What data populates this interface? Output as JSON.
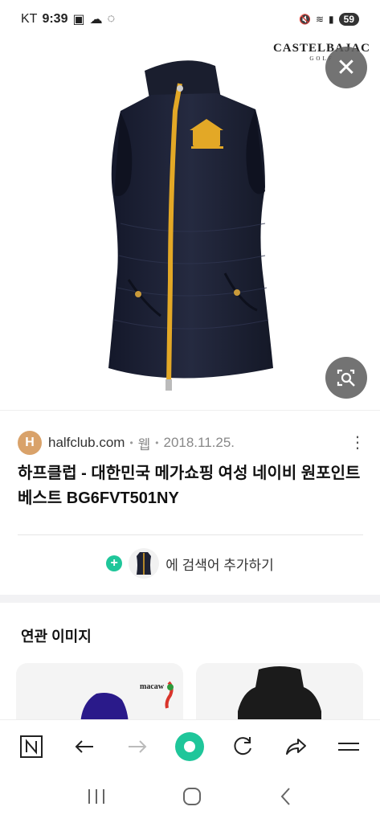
{
  "status_bar": {
    "carrier": "KT",
    "time": "9:39",
    "battery": "59"
  },
  "image_brand": {
    "line1": "CASTELBAJAC",
    "line2": "GOLF"
  },
  "result": {
    "favicon_letter": "H",
    "site": "halfclub.com",
    "type": "웹",
    "date": "2018.11.25.",
    "title": "하프클럽 - 대한민국 메가쇼핑 여성 네이비 원포인트 베스트 BG6FVT501NY"
  },
  "add_search": {
    "label": "에 검색어 추가하기"
  },
  "related": {
    "heading": "연관 이미지",
    "card1_logo": "macaw"
  },
  "colors": {
    "accent_green": "#1fc69a",
    "vest_navy": "#1e2233",
    "zipper_gold": "#e3a826"
  }
}
